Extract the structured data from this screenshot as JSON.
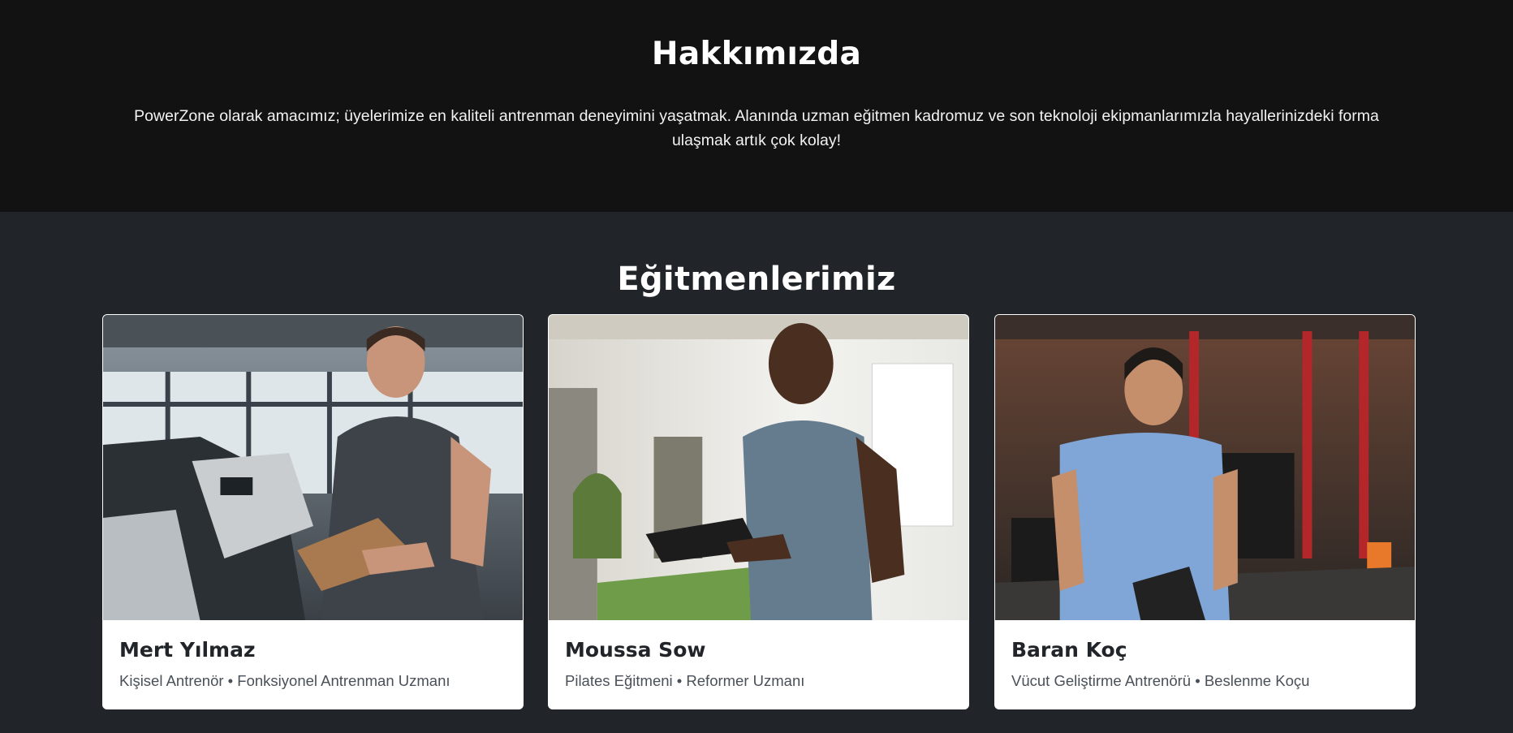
{
  "about": {
    "title": "Hakkımızda",
    "text": "PowerZone olarak amacımız; üyelerimize en kaliteli antrenman deneyimini yaşatmak. Alanında uzman eğitmen kadromuz ve son teknoloji ekipmanlarımızla hayallerinizdeki forma ulaşmak artık çok kolay!"
  },
  "trainers": {
    "title": "Eğitmenlerimiz",
    "cards": [
      {
        "name": "Mert Yılmaz",
        "role": "Kişisel Antrenör • Fonksiyonel Antrenman Uzmanı",
        "photo": "trainer-photo-gym-treadmills"
      },
      {
        "name": "Moussa Sow",
        "role": "Pilates Eğitmeni • Reformer Uzmanı",
        "photo": "trainer-photo-bright-studio"
      },
      {
        "name": "Baran Koç",
        "role": "Vücut Geliştirme Antrenörü • Beslenme Koçu",
        "photo": "trainer-photo-crossfit-gym"
      }
    ]
  },
  "colors": {
    "about_bg": "#121212",
    "trainers_bg": "#212529",
    "card_bg": "#ffffff",
    "text_dark": "#212529",
    "text_muted": "#495057"
  }
}
